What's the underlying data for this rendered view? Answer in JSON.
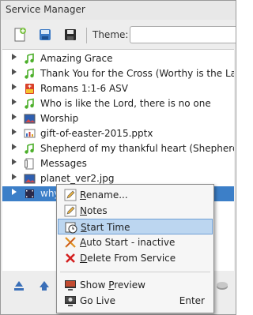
{
  "window": {
    "title": "Service Manager"
  },
  "toolbar": {
    "buttons": [
      {
        "name": "new-service-button",
        "icon": "new-document-icon"
      },
      {
        "name": "open-service-button",
        "icon": "open-file-icon"
      },
      {
        "name": "save-service-button",
        "icon": "floppy-save-icon"
      }
    ],
    "theme_label": "Theme:",
    "theme_value": ""
  },
  "service_items": [
    {
      "label": "Amazing Grace",
      "icon": "song-icon"
    },
    {
      "label": "Thank You for the Cross (Worthy is the Lamb)",
      "icon": "song-icon"
    },
    {
      "label": "Romans 1:1-6 ASV",
      "icon": "bible-icon"
    },
    {
      "label": "Who is like the Lord, there is no one",
      "icon": "song-icon"
    },
    {
      "label": "Worship",
      "icon": "image-icon"
    },
    {
      "label": "gift-of-easter-2015.pptx",
      "icon": "presentation-icon"
    },
    {
      "label": "Shepherd of my thankful heart (Shepherd of",
      "icon": "song-icon"
    },
    {
      "label": "Messages",
      "icon": "custom-slide-icon"
    },
    {
      "label": "planet_ver2.jpg",
      "icon": "image-icon"
    },
    {
      "label": "why.ne.mp4",
      "icon": "media-icon",
      "selected": true
    }
  ],
  "context_menu": {
    "items": [
      {
        "label": "Rename...",
        "underline": "R",
        "rest": "ename...",
        "icon": "pencil-icon"
      },
      {
        "label": "Notes",
        "underline": "N",
        "rest": "otes",
        "icon": "pencil-icon"
      },
      {
        "label": "Start Time",
        "underline": "S",
        "rest": "tart Time",
        "icon": "clock-icon",
        "highlighted": true
      },
      {
        "label": "Auto Start - inactive",
        "underline": "A",
        "rest": "uto Start - inactive",
        "icon": "auto-start-icon"
      },
      {
        "label": "Delete From Service",
        "underline": "D",
        "rest": "elete From Service",
        "icon": "delete-x-icon"
      },
      {
        "label": "Show Preview",
        "underline": "P",
        "pre": "Show ",
        "rest": "review",
        "icon": "preview-icon"
      },
      {
        "label": "Go Live",
        "pre": "Go Live",
        "icon": "live-icon",
        "shortcut": "Enter"
      }
    ]
  },
  "bottom_bar": {
    "buttons": [
      {
        "name": "move-to-top-button",
        "icon": "move-top-icon"
      },
      {
        "name": "move-up-button",
        "icon": "move-up-icon"
      },
      {
        "name": "go-live-bottom-button",
        "icon": "live-icon"
      }
    ]
  },
  "colors": {
    "selection": "#3c7fc8",
    "menu_highlight": "#bcd6f0"
  }
}
